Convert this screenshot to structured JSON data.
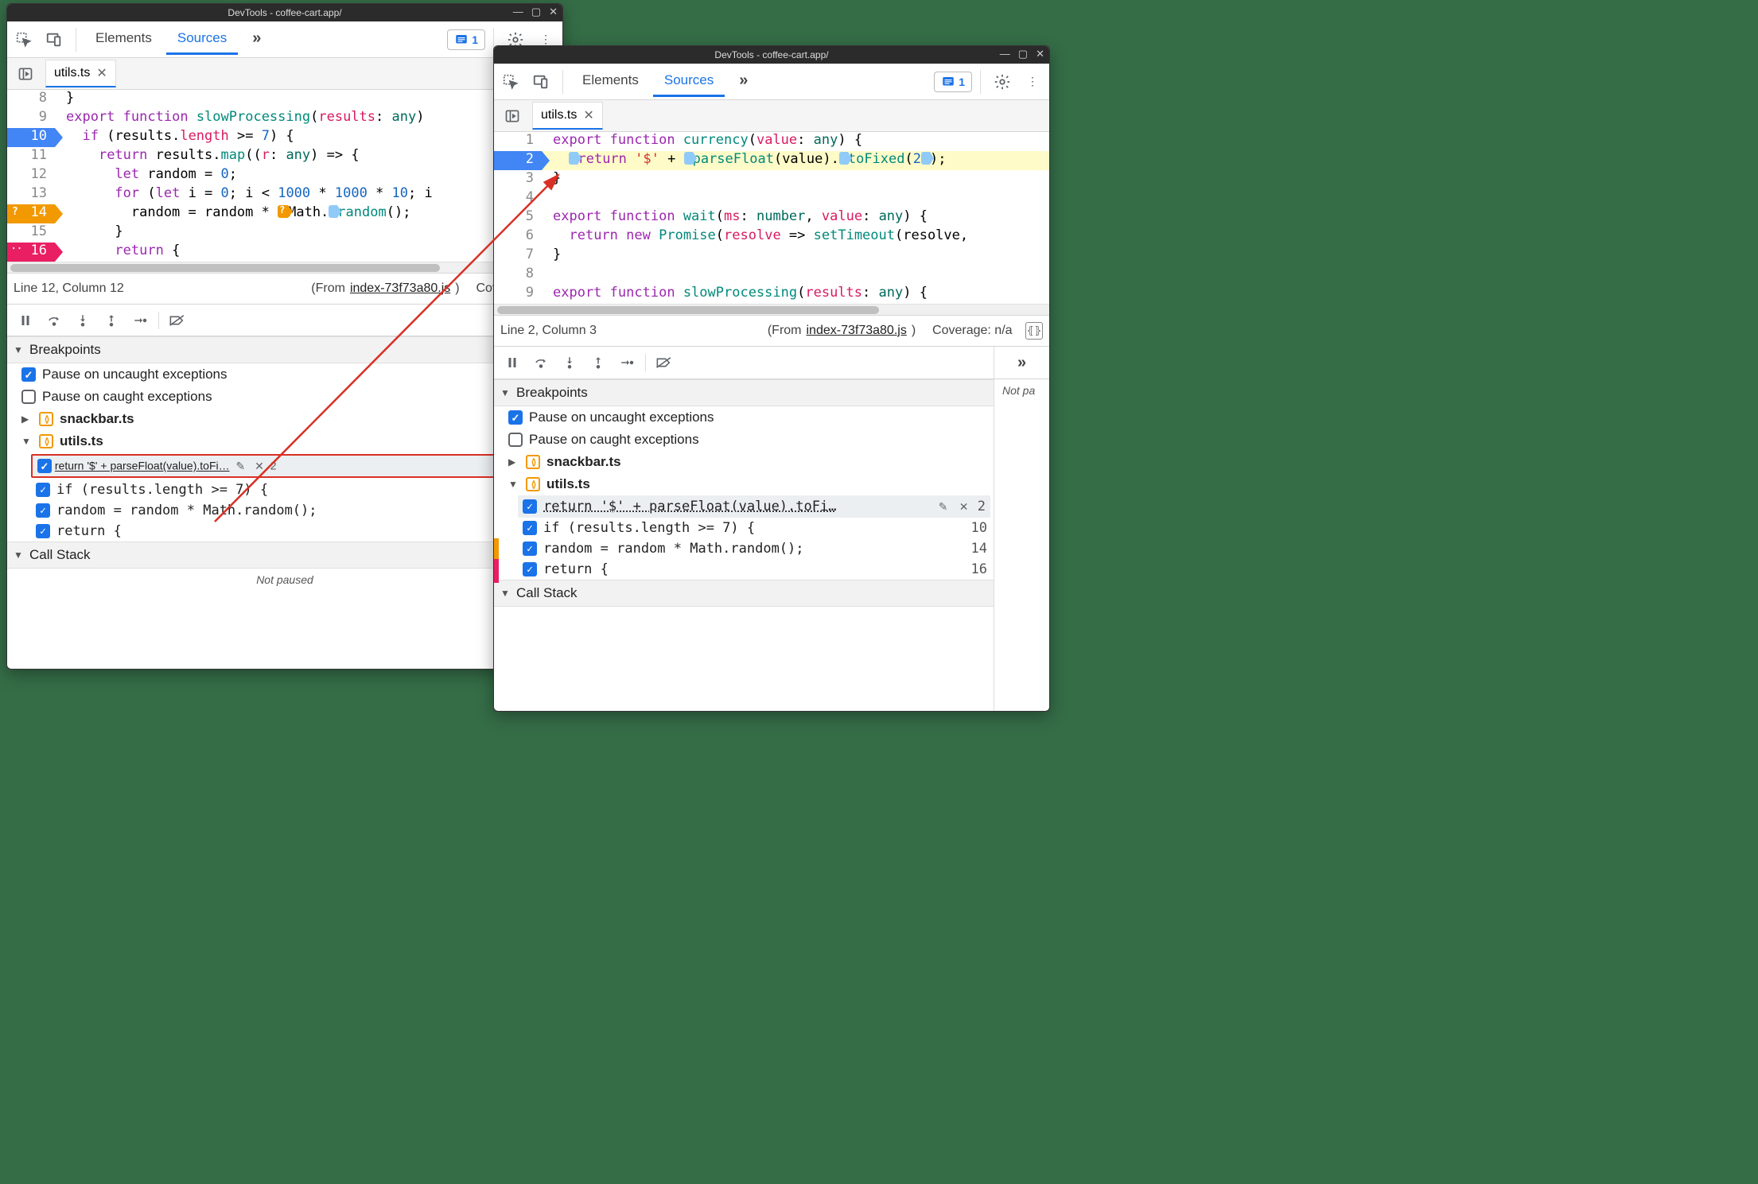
{
  "window_title": "DevTools - coffee-cart.app/",
  "toptabs": {
    "elements": "Elements",
    "sources": "Sources",
    "more": "»"
  },
  "issues_count": "1",
  "filetab": {
    "name": "utils.ts"
  },
  "left_code": {
    "lines": [
      {
        "n": "8",
        "html": "}"
      },
      {
        "n": "9",
        "html": "<span class='tok-kw'>export</span> <span class='tok-kw'>function</span> <span class='tok-fn'>slowProcessing</span>(<span class='tok-prop'>results</span>: <span class='tok-type'>any</span>)"
      },
      {
        "n": "10",
        "bp": "blue",
        "html": "  <span class='tok-kw'>if</span> (results.<span class='tok-prop'>length</span> >= <span class='tok-num'>7</span>) {"
      },
      {
        "n": "11",
        "html": "    <span class='tok-kw'>return</span> results.<span class='tok-fn'>map</span>((<span class='tok-prop'>r</span>: <span class='tok-type'>any</span>) => {"
      },
      {
        "n": "12",
        "html": "      <span class='tok-kw'>let</span> random = <span class='tok-num'>0</span>;"
      },
      {
        "n": "13",
        "html": "      <span class='tok-kw'>for</span> (<span class='tok-kw'>let</span> i = <span class='tok-num'>0</span>; i < <span class='tok-num'>1000</span> * <span class='tok-num'>1000</span> * <span class='tok-num'>10</span>; i"
      },
      {
        "n": "14",
        "bp": "orange",
        "html": "        random = random * <span class='marker-orange'></span>Math.<span class='marker-blue'></span><span class='tok-fn'>random</span>();"
      },
      {
        "n": "15",
        "html": "      }"
      },
      {
        "n": "16",
        "bp": "pink",
        "html": "      <span class='tok-kw'>return</span> {"
      }
    ]
  },
  "right_code": {
    "lines": [
      {
        "n": "1",
        "html": "<span class='tok-kw'>export</span> <span class='tok-kw'>function</span> <span class='tok-fn'>currency</span>(<span class='tok-prop'>value</span>: <span class='tok-type'>any</span>) {"
      },
      {
        "n": "2",
        "bp": "blue",
        "hl": true,
        "html": "  <span class='marker-blue'></span><span class='tok-kw'>return</span> <span class='tok-str'>'$'</span> + <span class='marker-blue'></span><span class='tok-fn'>parseFloat</span>(value).<span class='marker-blue'></span><span class='tok-fn'>toFixed</span>(<span class='tok-num'>2</span><span class='marker-blue'></span>);"
      },
      {
        "n": "3",
        "html": "}"
      },
      {
        "n": "4",
        "html": ""
      },
      {
        "n": "5",
        "html": "<span class='tok-kw'>export</span> <span class='tok-kw'>function</span> <span class='tok-fn'>wait</span>(<span class='tok-prop'>ms</span>: <span class='tok-type'>number</span>, <span class='tok-prop'>value</span>: <span class='tok-type'>any</span>) {"
      },
      {
        "n": "6",
        "html": "  <span class='tok-kw'>return</span> <span class='tok-kw'>new</span> <span class='tok-fn'>Promise</span>(<span class='tok-prop'>resolve</span> => <span class='tok-fn'>setTimeout</span>(resolve,"
      },
      {
        "n": "7",
        "html": "}"
      },
      {
        "n": "8",
        "html": ""
      },
      {
        "n": "9",
        "html": "<span class='tok-kw'>export</span> <span class='tok-kw'>function</span> <span class='tok-fn'>slowProcessing</span>(<span class='tok-prop'>results</span>: <span class='tok-type'>any</span>) {"
      }
    ]
  },
  "status_left": {
    "pos": "Line 12, Column 12",
    "from": "(From ",
    "file": "index-73f73a80.js",
    "close": ")",
    "coverage": "Coverage: n/a"
  },
  "status_right": {
    "pos": "Line 2, Column 3",
    "from": "(From ",
    "file": "index-73f73a80.js",
    "close": ")",
    "coverage": "Coverage: n/a"
  },
  "panes": {
    "breakpoints": "Breakpoints",
    "pause_uncaught": "Pause on uncaught exceptions",
    "pause_caught": "Pause on caught exceptions",
    "file1": "snackbar.ts",
    "file2": "utils.ts",
    "bp1": {
      "text": "return '$' + parseFloat(value).toFi…",
      "ln": "2"
    },
    "bp1_r": {
      "text": "return '$' + parseFloat(value).toFi…",
      "ln": "2"
    },
    "bp2": {
      "text": "if (results.length >= 7) {",
      "ln": "10"
    },
    "bp3": {
      "text": "random = random * Math.random();",
      "ln": "14"
    },
    "bp4": {
      "text": "return {",
      "ln": "16"
    },
    "callstack": "Call Stack",
    "notpaused": "Not paused",
    "notpaused_clip": "Not pa"
  }
}
